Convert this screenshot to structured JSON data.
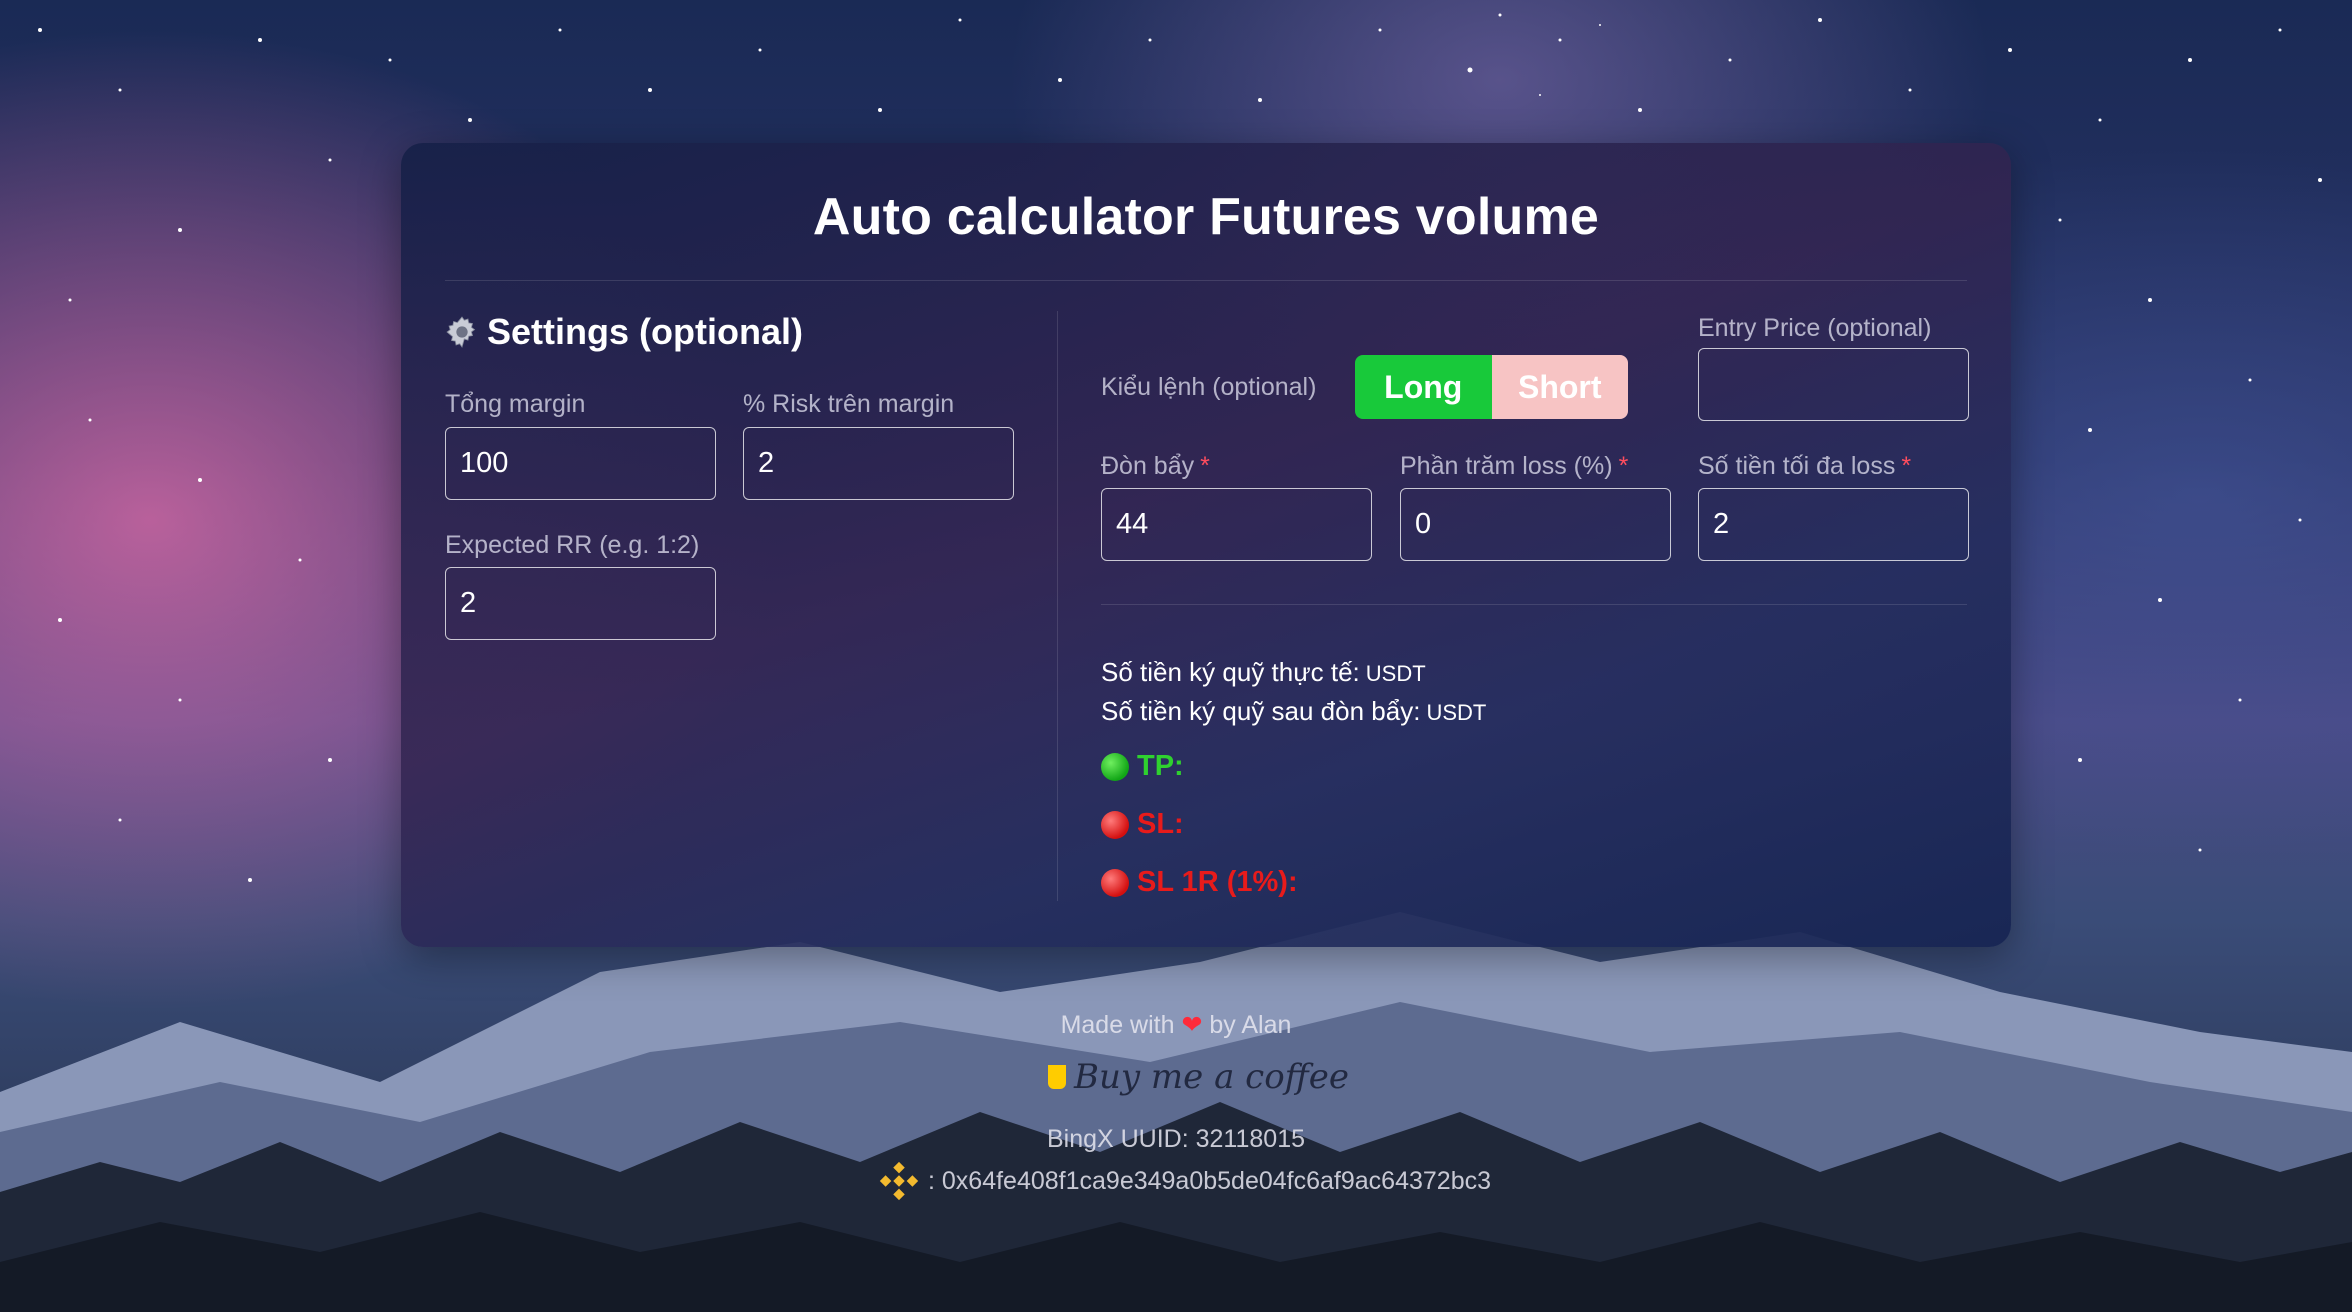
{
  "title": "Auto calculator Futures volume",
  "settings": {
    "icon": "gear-icon",
    "heading": "Settings (optional)",
    "total_margin_label": "Tổng margin",
    "total_margin_value": "100",
    "risk_label": "% Risk trên margin",
    "risk_value": "2",
    "rr_label": "Expected RR (e.g. 1:2)",
    "rr_value": "2"
  },
  "order": {
    "type_label": "Kiểu lệnh (optional)",
    "long_label": "Long",
    "short_label": "Short",
    "entry_label": "Entry Price (optional)",
    "entry_value": "",
    "leverage_label": "Đòn bẩy",
    "leverage_value": "44",
    "loss_pct_label": "Phần trăm loss (%)",
    "loss_pct_value": "0",
    "max_loss_label": "Số tiền tối đa loss",
    "max_loss_value": "2",
    "required_mark": "*"
  },
  "results": {
    "actual_margin_label": "Số tiền ký quỹ thực tế:",
    "leveraged_margin_label": "Số tiền ký quỹ sau đòn bẩy:",
    "unit": "USDT",
    "tp_label": "TP:",
    "sl_label": "SL:",
    "sl1r_label": "SL 1R (1%):"
  },
  "footer": {
    "made_with": "Made with",
    "by": "by Alan",
    "coffee_text": "Buy me a coffee",
    "bingx": "BingX UUID: 32118015",
    "wallet": ": 0x64fe408f1ca9e349a0b5de04fc6af9ac64372bc3"
  },
  "colors": {
    "long": "#18c93a",
    "short": "#f7c4c4",
    "tp": "#2fd12f",
    "sl": "#e81b1b"
  }
}
